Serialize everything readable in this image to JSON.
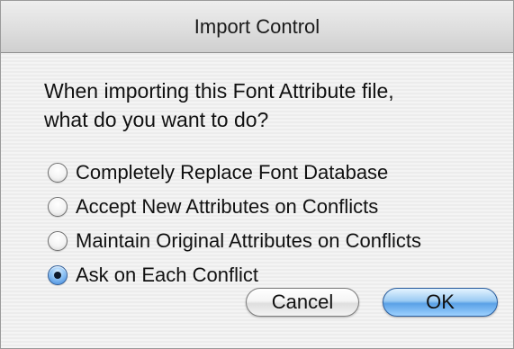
{
  "dialog": {
    "title": "Import Control",
    "prompt": "When importing this Font Attribute file,\nwhat do you want to do?",
    "options": [
      {
        "label": "Completely Replace Font Database",
        "selected": false
      },
      {
        "label": "Accept New Attributes on Conflicts",
        "selected": false
      },
      {
        "label": "Maintain Original Attributes on Conflicts",
        "selected": false
      },
      {
        "label": "Ask on Each Conflict",
        "selected": true
      }
    ],
    "buttons": {
      "cancel": "Cancel",
      "ok": "OK"
    }
  },
  "colors": {
    "default_button": "#5aa1e6",
    "selected_radio": "#3d83d8"
  }
}
